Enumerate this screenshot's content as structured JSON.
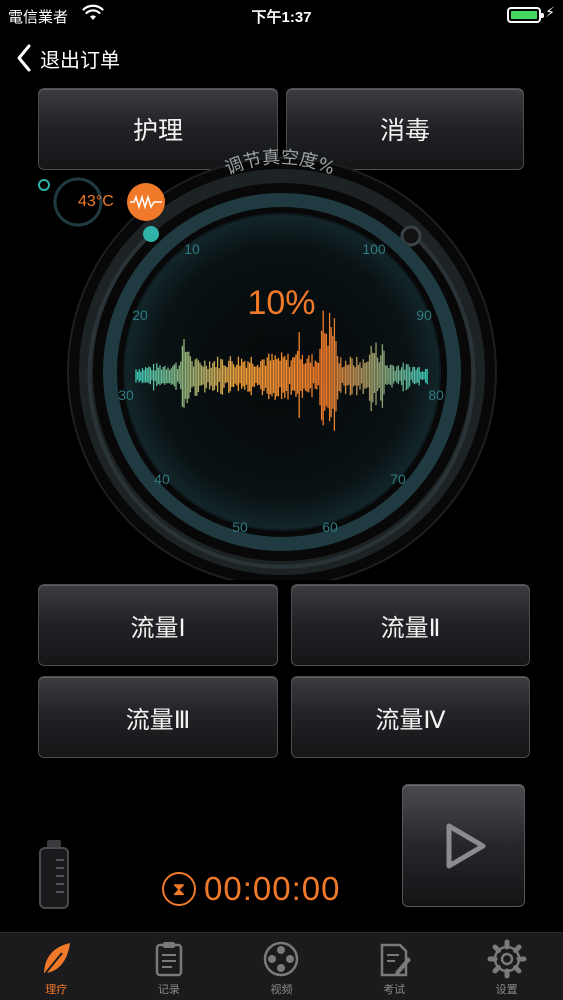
{
  "status": {
    "carrier": "電信業者",
    "time": "下午1:37"
  },
  "nav": {
    "back_label": "退出订单"
  },
  "mode_buttons": {
    "left": "护理",
    "right": "消毒"
  },
  "temperature": {
    "value": "43°C"
  },
  "gauge": {
    "title": "调节真空度%",
    "value_text": "10%",
    "ticks": {
      "t10": "10",
      "t20": "20",
      "t30": "30",
      "t40": "40",
      "t50": "50",
      "t100": "100",
      "t90": "90",
      "t80": "80",
      "t70": "70",
      "t60": "60"
    }
  },
  "flow_buttons": {
    "f1": "流量Ⅰ",
    "f2": "流量Ⅱ",
    "f3": "流量Ⅲ",
    "f4": "流量Ⅳ"
  },
  "timer": {
    "value": "00:00:00"
  },
  "tabs": [
    {
      "label": "理疗",
      "icon": "leaf-icon",
      "active": true
    },
    {
      "label": "记录",
      "icon": "clipboard-icon"
    },
    {
      "label": "视频",
      "icon": "film-reel-icon"
    },
    {
      "label": "考试",
      "icon": "exam-pen-icon"
    },
    {
      "label": "设置",
      "icon": "gear-icon"
    }
  ],
  "colors": {
    "accent": "#f07a2a",
    "teal": "#2fb3a8",
    "ring": "#1f3a40",
    "dial": "#0c1416"
  }
}
